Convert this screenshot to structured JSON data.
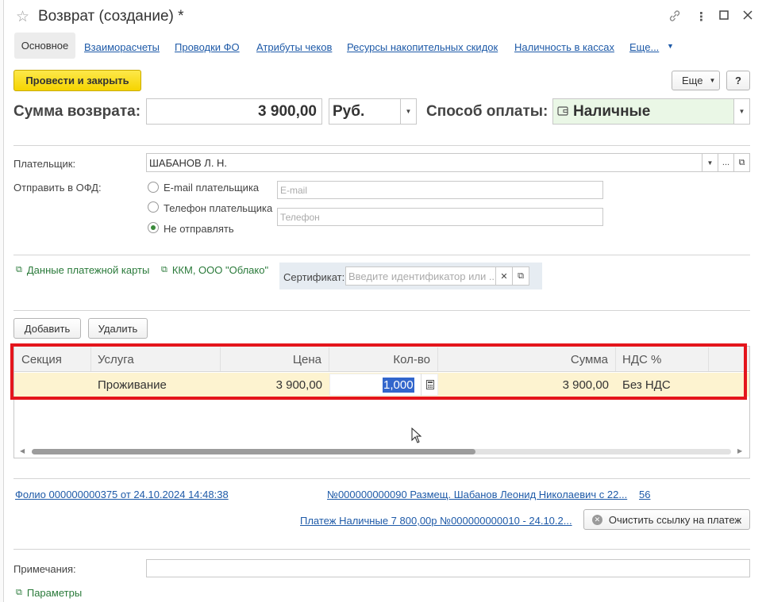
{
  "window": {
    "title": "Возврат (создание) *"
  },
  "tabs": [
    {
      "label": "Основное"
    },
    {
      "label": "Взаиморасчеты"
    },
    {
      "label": "Проводки ФО"
    },
    {
      "label": "Атрибуты чеков"
    },
    {
      "label": "Ресурсы накопительных скидок"
    },
    {
      "label": "Наличность в кассах"
    },
    {
      "label": "Еще..."
    }
  ],
  "toolbar": {
    "post_close_label": "Провести и закрыть",
    "more_label": "Еще",
    "help_label": "?"
  },
  "summary": {
    "amount_label": "Сумма возврата:",
    "amount_value": "3 900,00",
    "currency_value": "Руб.",
    "payment_label": "Способ оплаты:",
    "payment_value": "Наличные"
  },
  "payer": {
    "label": "Плательщик:",
    "value": "ШАБАНОВ Л. Н."
  },
  "ofd": {
    "label": "Отправить в ОФД:",
    "options": [
      {
        "label": "E-mail плательщика",
        "selected": false
      },
      {
        "label": "Телефон плательщика",
        "selected": false
      },
      {
        "label": "Не отправлять",
        "selected": true
      }
    ],
    "email_placeholder": "E-mail",
    "phone_placeholder": "Телефон"
  },
  "links": {
    "card_data": "Данные платежной карты",
    "kkm": "ККМ, ООО \"Облако\""
  },
  "certificate": {
    "label": "Сертификат:",
    "placeholder": "Введите идентификатор или ..."
  },
  "grid_toolbar": {
    "add_label": "Добавить",
    "delete_label": "Удалить"
  },
  "grid": {
    "columns": [
      "Секция",
      "Услуга",
      "Цена",
      "Кол-во",
      "Сумма",
      "НДС %"
    ],
    "rows": [
      {
        "section": "",
        "service": "Проживание",
        "price": "3 900,00",
        "qty": "1,000",
        "sum": "3 900,00",
        "vat": "Без НДС"
      }
    ]
  },
  "bottom_links": {
    "folio": "Фолио 000000000375 от 24.10.2024 14:48:38",
    "placement": "№000000000090 Размещ. Шабанов Леонид Николаевич с 22...",
    "placement_count": "56",
    "payment": "Платеж Наличные 7 800,00р №000000000010 - 24.10.2...",
    "clear_label": "Очистить ссылку на платеж"
  },
  "notes": {
    "label": "Примечания:",
    "value": ""
  },
  "params": {
    "label": "Параметры"
  },
  "colors": {
    "accent_yellow": "#f6d400",
    "payment_field_bg": "#eaf7e6",
    "selected_row_bg": "#fdf3d0",
    "highlight_border": "#e4151c",
    "link_blue": "#1e5aa8",
    "link_green": "#2a7a3a"
  }
}
